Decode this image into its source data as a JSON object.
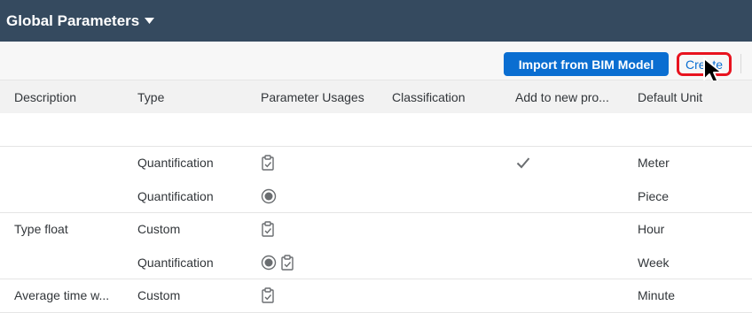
{
  "header": {
    "title": "Global Parameters",
    "caret_icon": "triangle-down-icon"
  },
  "toolbar": {
    "import_label": "Import from BIM Model",
    "create_label": "Create"
  },
  "table": {
    "columns": [
      "Description",
      "Type",
      "Parameter Usages",
      "Classification",
      "Add to new pro...",
      "Default Unit"
    ],
    "rows": [
      {
        "description": "",
        "type": "",
        "usages": [],
        "classification": "",
        "add_to_new": false,
        "unit": ""
      },
      {
        "description": "",
        "type": "Quantification",
        "usages": [
          "clipboard-icon"
        ],
        "classification": "",
        "add_to_new": true,
        "unit": "Meter"
      },
      {
        "description": "",
        "type": "Quantification",
        "usages": [
          "radio-target-icon"
        ],
        "classification": "",
        "add_to_new": false,
        "unit": "Piece"
      },
      {
        "description": "Type float",
        "type": "Custom",
        "usages": [
          "clipboard-icon"
        ],
        "classification": "",
        "add_to_new": false,
        "unit": "Hour"
      },
      {
        "description": "",
        "type": "Quantification",
        "usages": [
          "radio-target-icon",
          "clipboard-icon"
        ],
        "classification": "",
        "add_to_new": false,
        "unit": "Week"
      },
      {
        "description": "Average time w...",
        "type": "Custom",
        "usages": [
          "clipboard-icon"
        ],
        "classification": "",
        "add_to_new": false,
        "unit": "Minute"
      }
    ]
  },
  "colors": {
    "shell": "#354a5f",
    "accent": "#0a6ed1",
    "highlight": "#e8131f"
  }
}
